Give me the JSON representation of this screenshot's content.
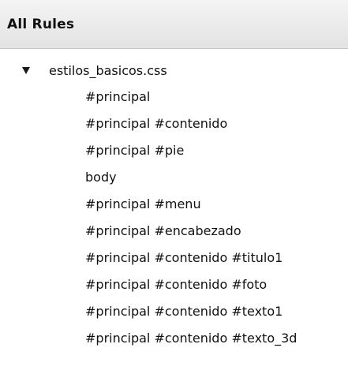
{
  "header": {
    "title": "All Rules"
  },
  "tree": {
    "file": {
      "name": "estilos_basicos.css",
      "expanded": true,
      "disclosure_icon": "triangle-down-icon"
    },
    "rules": [
      "#principal",
      "#principal #contenido",
      "#principal #pie",
      "body",
      "#principal #menu",
      "#principal #encabezado",
      "#principal #contenido #titulo1",
      "#principal #contenido #foto",
      "#principal #contenido #texto1",
      "#principal #contenido #texto_3d"
    ]
  }
}
